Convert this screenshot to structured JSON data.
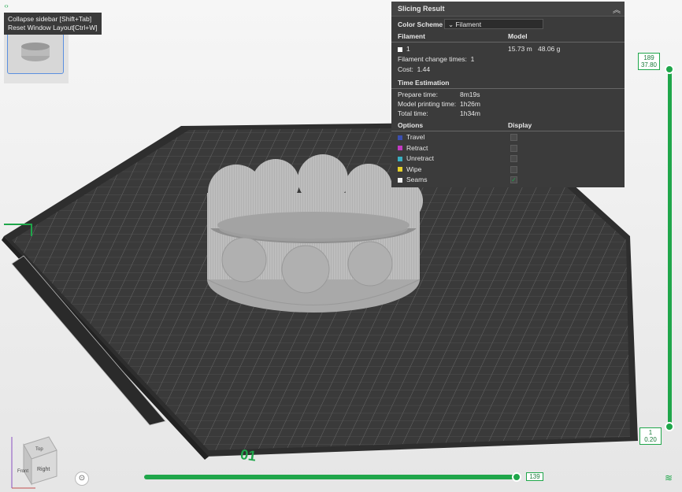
{
  "sidebar": {
    "toggle_icon": "collapse-sidebar-icon",
    "tooltip_line1": "Collapse sidebar [Shift+Tab]",
    "tooltip_line2": "Reset Window Layout[Ctrl+W]"
  },
  "slicing_result": {
    "title": "Slicing Result",
    "color_scheme_label": "Color Scheme",
    "color_scheme_value": "Filament",
    "filament_header": "Filament",
    "model_header": "Model",
    "filament_id": "1",
    "model_length": "15.73 m",
    "model_weight": "48.06 g",
    "change_times_label": "Filament change times:",
    "change_times_value": "1",
    "cost_label": "Cost:",
    "cost_value": "1.44",
    "time_header": "Time Estimation",
    "prepare_label": "Prepare time:",
    "prepare_value": "8m19s",
    "printing_label": "Model printing time:",
    "printing_value": "1h26m",
    "total_label": "Total time:",
    "total_value": "1h34m",
    "options_header": "Options",
    "display_header": "Display",
    "options": [
      {
        "label": "Travel",
        "color": "#3b4fb0",
        "checked": false
      },
      {
        "label": "Retract",
        "color": "#c23bc2",
        "checked": false
      },
      {
        "label": "Unretract",
        "color": "#3bb0c2",
        "checked": false
      },
      {
        "label": "Wipe",
        "color": "#e6d22a",
        "checked": false
      },
      {
        "label": "Seams",
        "color": "#f0f0f0",
        "checked": true
      }
    ]
  },
  "layer_slider": {
    "top_layer": "189",
    "top_height": "37.80",
    "bottom_layer": "1",
    "bottom_height": "0.20"
  },
  "move_slider": {
    "value": "139"
  },
  "plate": {
    "number": "01"
  },
  "view_cube": {
    "front": "Front",
    "right": "Right",
    "top": "Top"
  },
  "colors": {
    "accent": "#1fa64a",
    "plate": "#3a3a3a",
    "model": "#b9b9b9"
  }
}
